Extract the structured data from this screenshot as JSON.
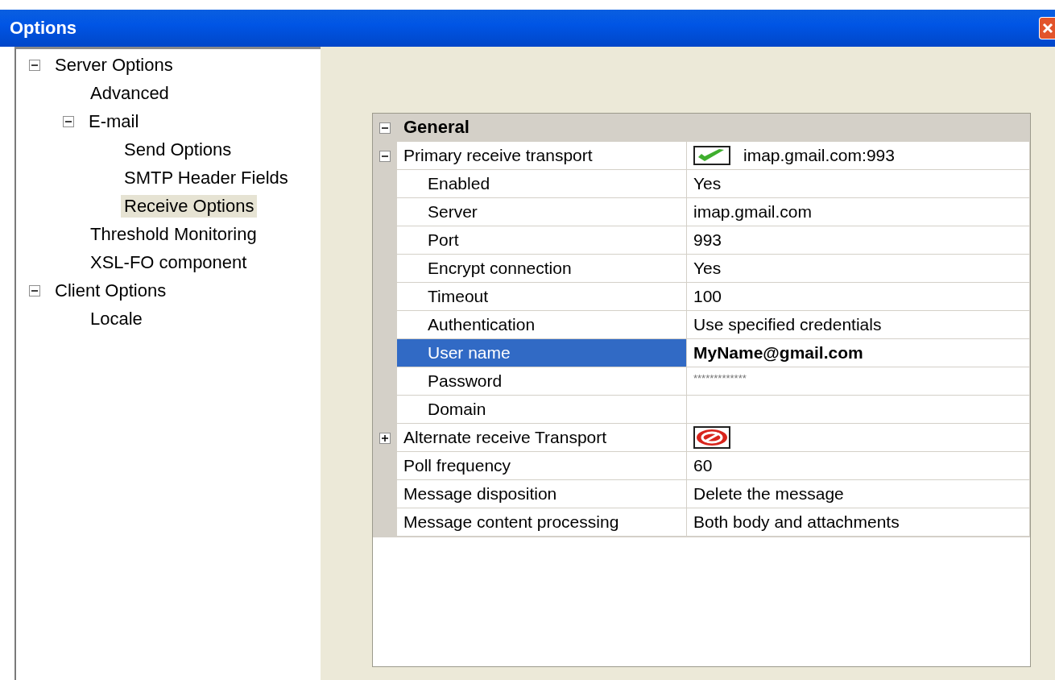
{
  "window": {
    "title": "Options"
  },
  "tree": [
    {
      "label": "Server Options",
      "expanded": true,
      "selected": false,
      "children": [
        {
          "label": "Advanced",
          "selected": false
        },
        {
          "label": "E-mail",
          "expanded": true,
          "selected": false,
          "children": [
            {
              "label": "Send Options",
              "selected": false
            },
            {
              "label": "SMTP Header Fields",
              "selected": false
            },
            {
              "label": "Receive Options",
              "selected": true
            }
          ]
        },
        {
          "label": "Threshold Monitoring",
          "selected": false
        },
        {
          "label": "XSL-FO component",
          "selected": false
        }
      ]
    },
    {
      "label": "Client Options",
      "expanded": true,
      "selected": false,
      "children": [
        {
          "label": "Locale",
          "selected": false
        }
      ]
    }
  ],
  "property_grid": {
    "category": {
      "label": "General",
      "expanded": true
    },
    "rows": [
      {
        "name": "Primary receive transport",
        "value": "imap.gmail.com:993",
        "connected": true,
        "expanded": true,
        "selected": false,
        "children": [
          {
            "name": "Enabled",
            "value": "Yes",
            "selected": false
          },
          {
            "name": "Server",
            "value": "imap.gmail.com",
            "selected": false
          },
          {
            "name": "Port",
            "value": "993",
            "selected": false
          },
          {
            "name": "Encrypt connection",
            "value": "Yes",
            "selected": false
          },
          {
            "name": "Timeout",
            "value": "100",
            "selected": false
          },
          {
            "name": "Authentication",
            "value": "Use specified credentials",
            "selected": false
          },
          {
            "name": "User name",
            "value": "MyName@gmail.com",
            "selected": true
          },
          {
            "name": "Password",
            "value": "*************",
            "kind": "masked",
            "selected": false
          },
          {
            "name": "Domain",
            "selected": false
          }
        ]
      },
      {
        "name": "Alternate receive Transport",
        "connected": false,
        "expanded": false,
        "selected": false
      },
      {
        "name": "Poll frequency",
        "value": "60",
        "selected": false
      },
      {
        "name": "Message disposition",
        "value": "Delete the message",
        "selected": false
      },
      {
        "name": "Message content processing",
        "value": "Both body and attachments",
        "selected": false
      }
    ]
  }
}
